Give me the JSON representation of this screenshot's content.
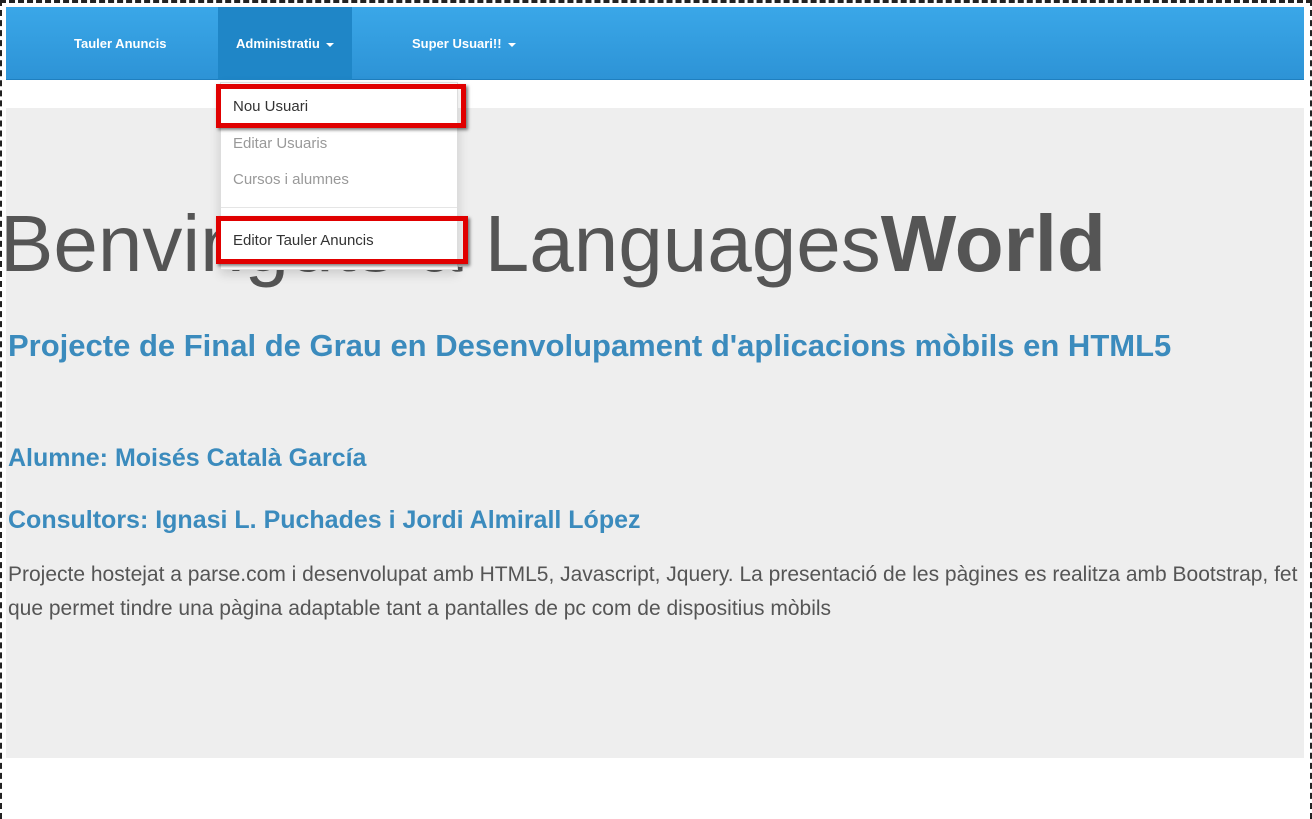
{
  "navbar": {
    "items": [
      {
        "label": "Tauler Anuncis",
        "has_caret": false
      },
      {
        "label": "Administratiu",
        "has_caret": true
      },
      {
        "label": "Super Usuari!!",
        "has_caret": true
      }
    ]
  },
  "dropdown": {
    "items": [
      {
        "label": "Nou Usuari"
      },
      {
        "label": "Editar Usuaris"
      },
      {
        "label": "Cursos i alumnes"
      },
      {
        "label": "Editor Tauler Anuncis"
      }
    ]
  },
  "jumbotron": {
    "title_prefix": "Benvinguts a Languages",
    "title_bold": "World",
    "subtitle": "Projecte de Final de Grau en Desenvolupament d'aplicacions mòbils en HTML5",
    "student": "Alumne: Moisés Català García",
    "consultors": "Consultors: Ignasi L. Puchades i Jordi Almirall López",
    "description": "Projecte hostejat a parse.com i desenvolupat amb HTML5, Javascript, Jquery. La presentació de les pàgines es realitza amb Bootstrap, fet que permet tindre una pàgina adaptable tant a pantalles de pc com de dispositius mòbils"
  },
  "colors": {
    "navbar": "#2d93d6",
    "highlight": "#e00000",
    "link_blue": "#3b8bbd",
    "jumbotron_bg": "#eeeeee"
  }
}
